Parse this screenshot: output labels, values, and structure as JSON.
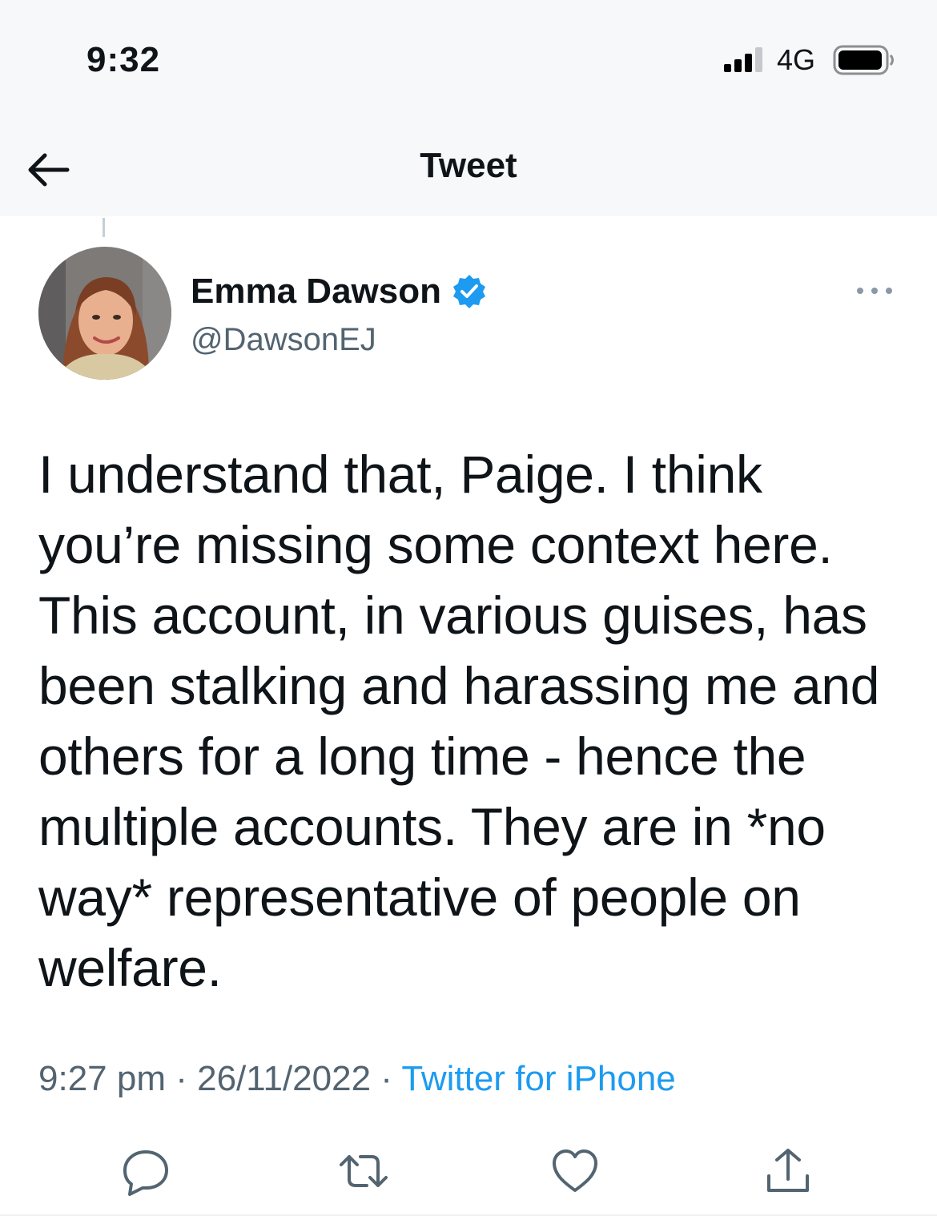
{
  "status_bar": {
    "time": "9:32",
    "network": "4G",
    "icons": [
      "signal-icon",
      "battery-icon"
    ]
  },
  "header": {
    "title": "Tweet",
    "back_icon": "arrow-left-icon"
  },
  "tweet": {
    "author_name": "Emma Dawson",
    "author_handle": "@DawsonEJ",
    "verified": true,
    "text_lines": [
      "I understand that, Paige. I think",
      "you’re missing some context here.",
      "This account, in various guises, has",
      "been stalking and harassing me and",
      "others for a long time - hence the",
      "multiple accounts. They are in *no",
      "way* representative of people on",
      "welfare."
    ],
    "time": "9:27 pm",
    "separator": "·",
    "date": "26/11/2022",
    "source": "Twitter for iPhone"
  },
  "actions": [
    "reply-icon",
    "retweet-icon",
    "like-icon",
    "share-icon"
  ],
  "colors": {
    "accent": "#1d9bf0",
    "text": "#0f1419",
    "secondary_text": "#536471",
    "header_bg": "#f7f8fa"
  }
}
